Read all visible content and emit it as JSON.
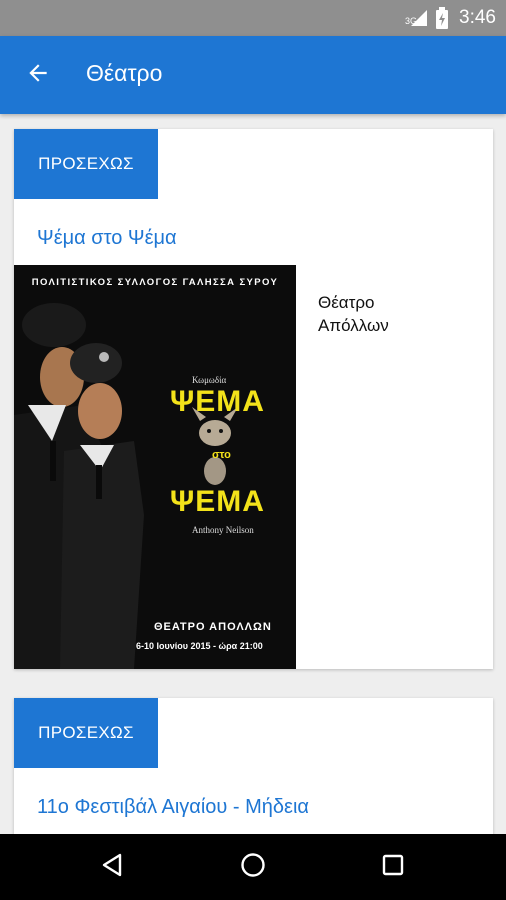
{
  "status_bar": {
    "time": "3:46",
    "network": "3G",
    "icons": [
      "signal-icon",
      "battery-charging-icon"
    ]
  },
  "app_bar": {
    "title": "Θέατρο",
    "back_icon": "arrow-back-icon"
  },
  "events": [
    {
      "tag": "ΠΡΟΣΕΧΩΣ",
      "title": "Ψέμα στο Ψέμα",
      "venue": "Θέατρο Απόλλων",
      "poster": {
        "header": "ΠΟΛΙΤΙΣΤΙΚΟΣ ΣΥΛΛΟΓΟΣ ΓΑΛΗΣΣΑ ΣΥΡΟΥ",
        "genre": "Κωμωδία",
        "title_top": "ΨΕΜΑ",
        "title_mid": "στο",
        "title_bottom": "ΨΕΜΑ",
        "author": "Anthony Neilson",
        "venue": "ΘΕΑΤΡΟ ΑΠΟΛΛΩΝ",
        "dates": "6-10 Ιουνίου 2015 - ώρα 21:00"
      }
    },
    {
      "tag": "ΠΡΟΣΕΧΩΣ",
      "title": "11ο Φεστιβάλ Αιγαίου - Μήδεια"
    }
  ],
  "nav_bar": {
    "icons": [
      "nav-back-icon",
      "nav-home-icon",
      "nav-recents-icon"
    ]
  },
  "colors": {
    "primary": "#1e76d3",
    "status_bar": "#8f8f8f",
    "background": "#eeeeee",
    "poster_title": "#f3e21a"
  }
}
